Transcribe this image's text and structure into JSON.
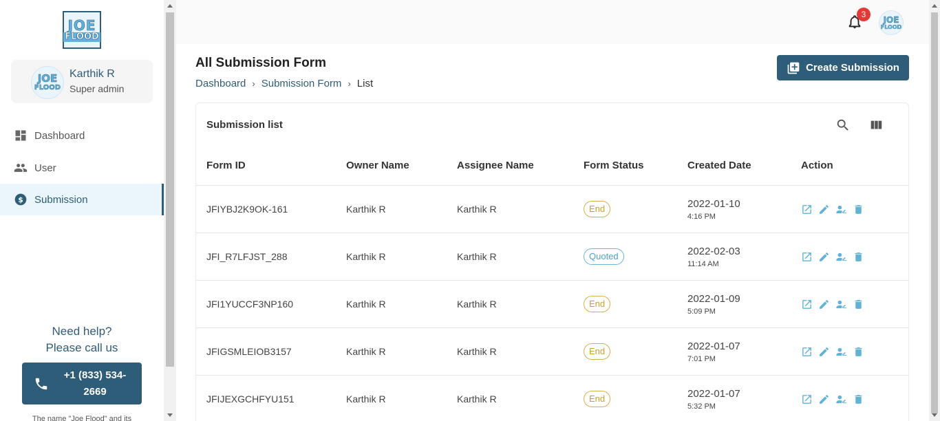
{
  "brand": {
    "logo_line1": "JOE",
    "logo_line2": "FLOOD"
  },
  "profile": {
    "name": "Karthik R",
    "role": "Super admin"
  },
  "nav": [
    {
      "label": "Dashboard",
      "icon": "dashboard-icon"
    },
    {
      "label": "User",
      "icon": "users-icon"
    },
    {
      "label": "Submission",
      "icon": "dollar-icon",
      "active": true
    }
  ],
  "help": {
    "line1": "Need help?",
    "line2": "Please call us",
    "phone_line1": "+1 (833) 534-",
    "phone_line2": "2669",
    "disclaimer": "The name \"Joe Flood\" and its"
  },
  "topbar": {
    "notification_count": "3"
  },
  "page": {
    "title": "All Submission Form",
    "breadcrumb": [
      "Dashboard",
      "Submission Form",
      "List"
    ],
    "create_label": "Create Submission"
  },
  "table": {
    "title": "Submission list",
    "columns": [
      "Form ID",
      "Owner Name",
      "Assignee Name",
      "Form Status",
      "Created Date",
      "Action"
    ],
    "rows": [
      {
        "id": "JFIYBJ2K9OK-161",
        "owner": "Karthik R",
        "assignee": "Karthik R",
        "status": "End",
        "date": "2022-01-10",
        "time": "4:16 PM"
      },
      {
        "id": "JFI_R7LFJST_288",
        "owner": "Karthik R",
        "assignee": "Karthik R",
        "status": "Quoted",
        "date": "2022-02-03",
        "time": "11:14 AM"
      },
      {
        "id": "JFI1YUCCF3NP160",
        "owner": "Karthik R",
        "assignee": "Karthik R",
        "status": "End",
        "date": "2022-01-09",
        "time": "5:09 PM"
      },
      {
        "id": "JFIGSMLEIOB3157",
        "owner": "Karthik R",
        "assignee": "Karthik R",
        "status": "End",
        "date": "2022-01-07",
        "time": "7:01 PM"
      },
      {
        "id": "JFIJEXGCHFYU151",
        "owner": "Karthik R",
        "assignee": "Karthik R",
        "status": "End",
        "date": "2022-01-07",
        "time": "5:32 PM"
      }
    ]
  },
  "colors": {
    "primary": "#2d5d78",
    "status_end": "#c9a227",
    "status_quoted": "#4aa3c8",
    "badge": "#e53935",
    "action_icon": "#5fb3d8"
  }
}
